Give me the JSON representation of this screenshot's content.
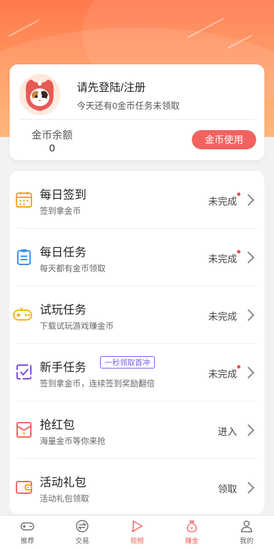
{
  "profile": {
    "login_title": "请先登陆/注册",
    "login_sub": "今天还有0金币任务未领取",
    "balance_label": "金币余额",
    "balance_value": "0",
    "use_button": "金币使用"
  },
  "tasks": [
    {
      "title": "每日签到",
      "sub": "签到拿金币",
      "status": "未完成",
      "dot": true,
      "icon": "calendar-icon",
      "color": "#f5a623"
    },
    {
      "title": "每日任务",
      "sub": "每天都有金币领取",
      "status": "未完成",
      "dot": true,
      "icon": "clipboard-icon",
      "color": "#3b8df2"
    },
    {
      "title": "试玩任务",
      "sub": "下载试玩游戏赚金币",
      "status": "未完成",
      "dot": false,
      "icon": "gamepad-icon",
      "color": "#f5b21b"
    },
    {
      "title": "新手任务",
      "sub": "签到拿金币，连续签到奖励翻倍",
      "status": "未完成",
      "dot": true,
      "icon": "checkbox-icon",
      "color": "#7a4ad8",
      "tag": "一秒领取首冲"
    },
    {
      "title": "抢红包",
      "sub": "海量金币等你来抢",
      "status": "进入",
      "dot": false,
      "icon": "red-envelope-icon",
      "color": "#f26360"
    },
    {
      "title": "活动礼包",
      "sub": "活动礼包领取",
      "status": "领取",
      "dot": false,
      "icon": "wallet-icon",
      "color": "#f26360"
    }
  ],
  "tabbar": [
    {
      "label": "推荐",
      "icon": "gamepad-icon",
      "active": false
    },
    {
      "label": "交易",
      "icon": "exchange-icon",
      "active": false
    },
    {
      "label": "视频",
      "icon": "play-icon",
      "active": true
    },
    {
      "label": "赚金",
      "icon": "money-bag-icon",
      "active": true
    },
    {
      "label": "我的",
      "icon": "user-icon",
      "active": false
    }
  ],
  "colors": {
    "accent": "#f26360",
    "hero_top": "#ff7a4f",
    "hero_bottom": "#ffb06a"
  }
}
